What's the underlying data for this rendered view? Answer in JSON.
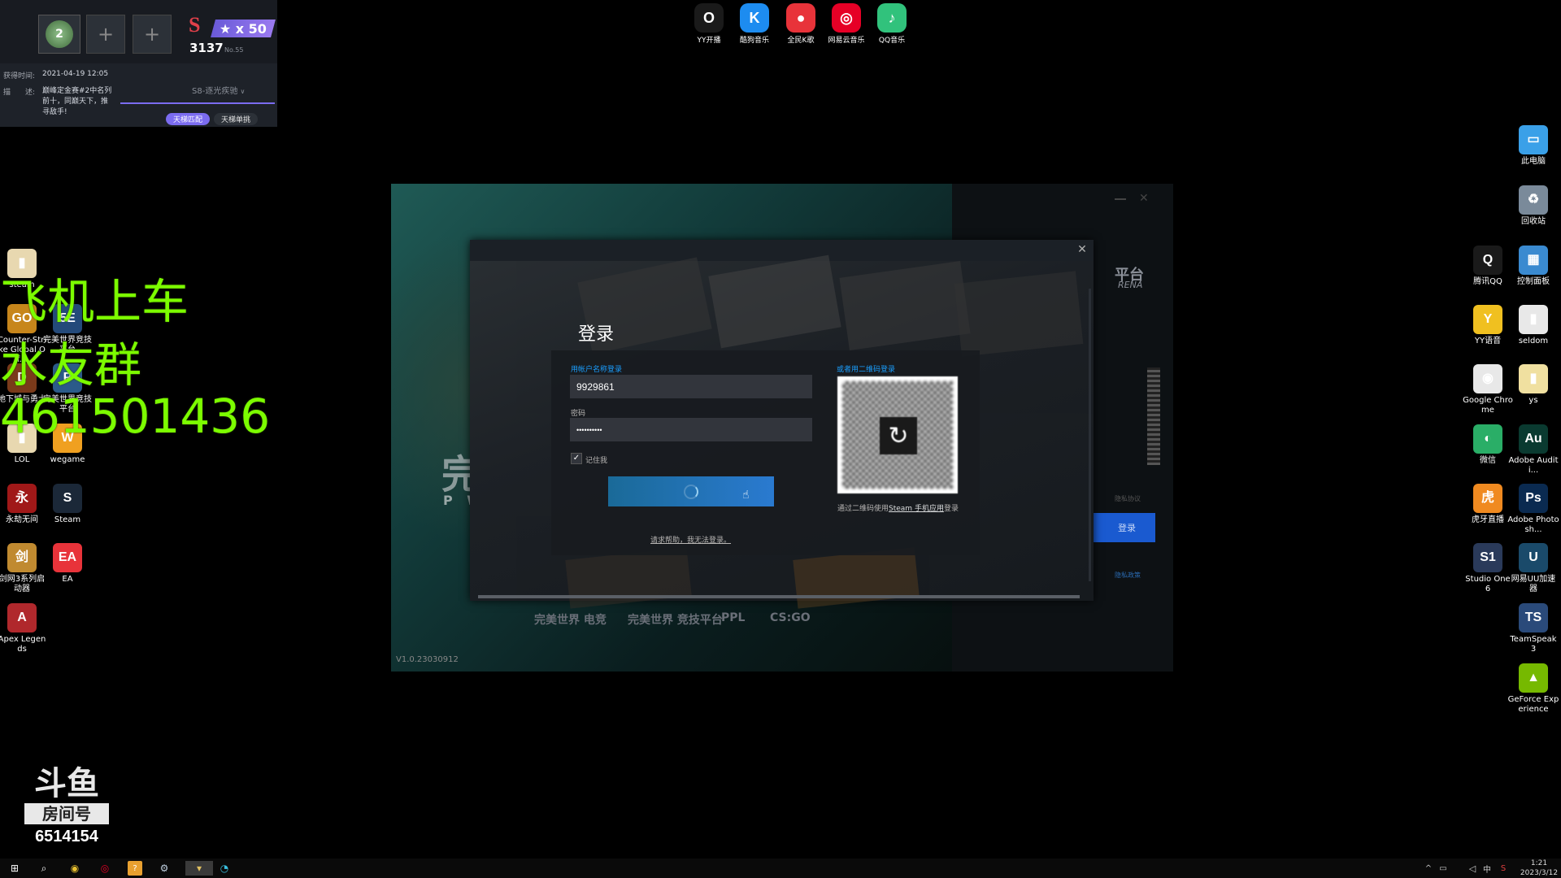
{
  "game_overlay": {
    "level": "2",
    "star_text": "★ x 50",
    "score": "3137",
    "rank": "No.55",
    "obtained_label": "获得时间:",
    "obtained_value": "2021-04-19 12:05",
    "desc_label": "描　　述:",
    "desc_value": "巅峰定金赛#2中名列前十，同巅天下，推寻敌手!",
    "season": "S8-逐光疾驰",
    "tab_active": "天梯匹配",
    "tab_other": "天梯单挑"
  },
  "promo": {
    "line1": "飞机上车",
    "line2": "水友群",
    "line3": "461501436"
  },
  "room": {
    "brand": "斗鱼",
    "label": "房间号",
    "number": "6514154"
  },
  "top_icons": [
    {
      "label": "YY开播",
      "glyph": "O",
      "color": "#1a1a1a"
    },
    {
      "label": "酷狗音乐",
      "glyph": "K",
      "color": "#1d8cf0"
    },
    {
      "label": "全民K歌",
      "glyph": "●",
      "color": "#e8333a"
    },
    {
      "label": "网易云音乐",
      "glyph": "◎",
      "color": "#e60026"
    },
    {
      "label": "QQ音乐",
      "glyph": "♪",
      "color": "#31c27c"
    }
  ],
  "left_icons": [
    {
      "label": "steam",
      "glyph": "▮",
      "color": "#e8d8b0"
    },
    {
      "label": "Counter-Strike Global Of...",
      "glyph": "GO",
      "color": "#c7861b"
    },
    {
      "label": "完美世界竞技平台",
      "glyph": "5E",
      "color": "#244a7a"
    },
    {
      "label": "地下城与勇士",
      "glyph": "D",
      "color": "#7a3a1a"
    },
    {
      "label": "完美世界竞技平台",
      "glyph": "P",
      "color": "#2b5b8a"
    },
    {
      "label": "LOL",
      "glyph": "▮",
      "color": "#e8d8b0"
    },
    {
      "label": "wegame",
      "glyph": "W",
      "color": "#f0a020"
    },
    {
      "label": "永劫无间",
      "glyph": "永",
      "color": "#a01818"
    },
    {
      "label": "Steam",
      "glyph": "S",
      "color": "#1b2838"
    },
    {
      "label": "剑网3系列启动器",
      "glyph": "剑",
      "color": "#c08a30"
    },
    {
      "label": "EA",
      "glyph": "EA",
      "color": "#e8333a"
    },
    {
      "label": "Apex Legends",
      "glyph": "A",
      "color": "#b0282c"
    }
  ],
  "right_icons": [
    {
      "label": "此电脑",
      "glyph": "▭",
      "color": "#3aa0e8"
    },
    {
      "label": "回收站",
      "glyph": "♻",
      "color": "#7a8a9a"
    },
    {
      "label": "腾讯QQ",
      "glyph": "Q",
      "color": "#1a1a1a"
    },
    {
      "label": "控制面板",
      "glyph": "▦",
      "color": "#3a8ad0"
    },
    {
      "label": "YY语音",
      "glyph": "Y",
      "color": "#f0c020"
    },
    {
      "label": "seldom",
      "glyph": "▮",
      "color": "#e8e8e8"
    },
    {
      "label": "Google Chrome",
      "glyph": "◉",
      "color": "#e8e8e8"
    },
    {
      "label": "ys",
      "glyph": "▮",
      "color": "#f0e0a0"
    },
    {
      "label": "微信",
      "glyph": "◐",
      "color": "#2aae67"
    },
    {
      "label": "Adobe Auditi...",
      "glyph": "Au",
      "color": "#0a3a30"
    },
    {
      "label": "虎牙直播",
      "glyph": "虎",
      "color": "#f08a20"
    },
    {
      "label": "Adobe Photosh...",
      "glyph": "Ps",
      "color": "#0a2a50"
    },
    {
      "label": "Studio One 6",
      "glyph": "S1",
      "color": "#2a3a5a"
    },
    {
      "label": "网易UU加速器",
      "glyph": "U",
      "color": "#1a4a6a"
    },
    {
      "label": "TeamSpeak 3",
      "glyph": "TS",
      "color": "#2a4a7a"
    },
    {
      "label": "GeForce Experience",
      "glyph": "▲",
      "color": "#76b900"
    }
  ],
  "launcher": {
    "platform_text": "平台",
    "arena_text": "RENA",
    "art_big_char": "完",
    "art_sub": "P W",
    "version": "V1.0.23030912",
    "side_login": "登录",
    "side_link": "隐私政策",
    "side_small": "隐私协议",
    "logos": [
      "完美世界 电竞",
      "完美世界 竞技平台",
      "PPL",
      "CS:GO"
    ]
  },
  "dialog": {
    "title": "登录",
    "account_label": "用帐户名称登录",
    "username_value": "9929861",
    "password_label": "密码",
    "password_value": "••••••••••",
    "remember_label": "记住我",
    "qr_label": "或者用二维码登录",
    "qr_hint_pre": "通过二维码使用",
    "qr_hint_link": "Steam 手机应用",
    "qr_hint_post": "登录",
    "help_link": "请求帮助，我无法登录。",
    "close_glyph": "✕"
  },
  "taskbar": {
    "time": "1:21",
    "date": "2023/3/12",
    "ime": "中",
    "icons": [
      "windows-start",
      "search",
      "chrome",
      "netease-music",
      "help",
      "steam",
      "launcher",
      "uu"
    ]
  },
  "colors": {
    "steam_blue": "#1a9fff",
    "promo_green": "#7cfc00",
    "overlay_purple": "#7b6cf0"
  }
}
